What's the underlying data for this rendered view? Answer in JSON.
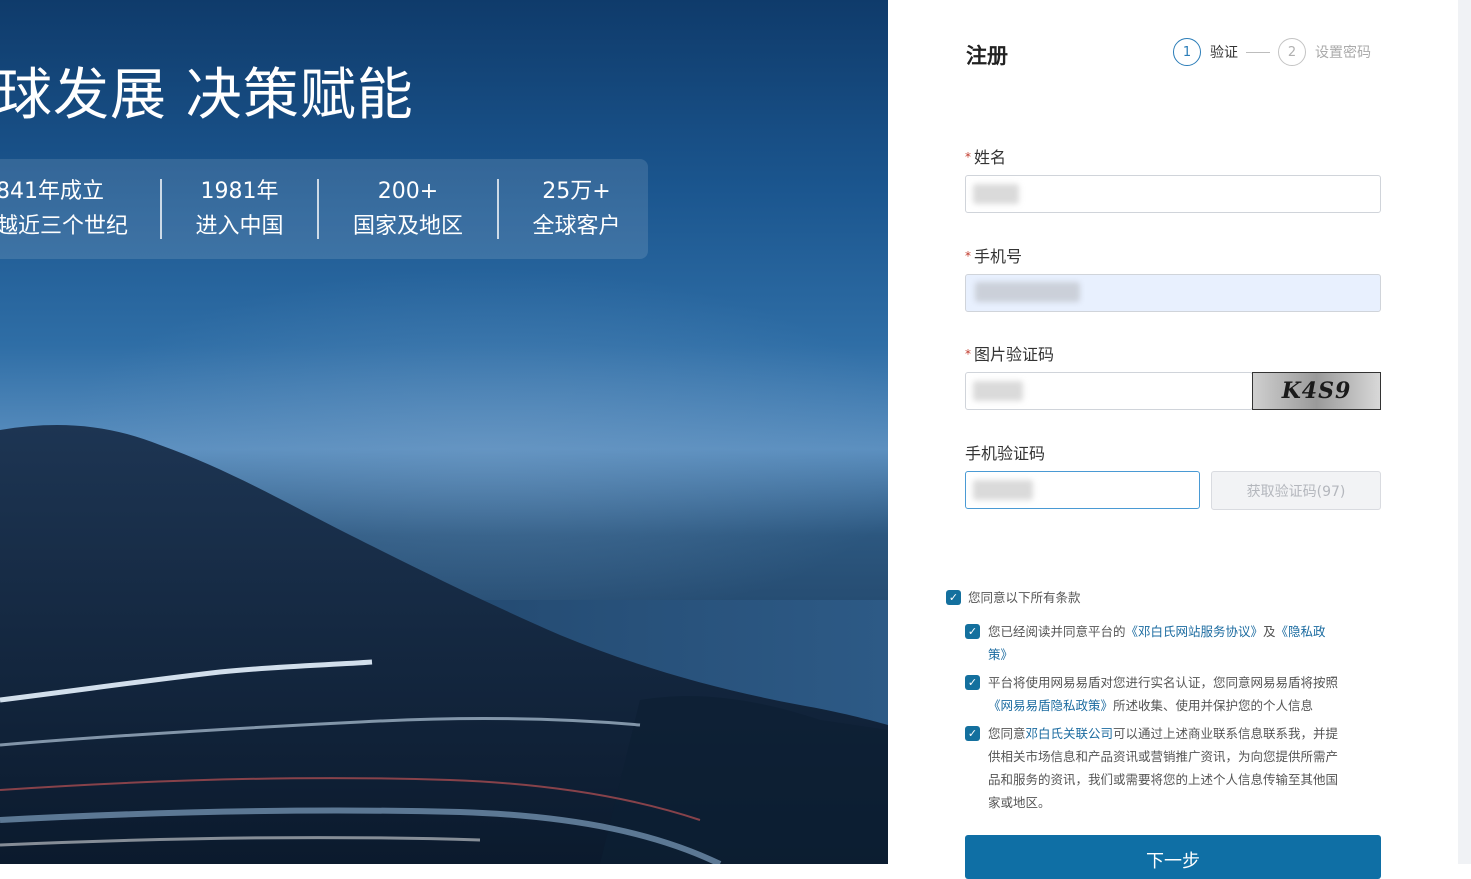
{
  "hero": {
    "title": "球发展 决策赋能",
    "stats": [
      {
        "line1": "841年成立",
        "line2": "越近三个世纪"
      },
      {
        "line1": "1981年",
        "line2": "进入中国"
      },
      {
        "line1": "200+",
        "line2": "国家及地区"
      },
      {
        "line1": "25万+",
        "line2": "全球客户"
      }
    ]
  },
  "form": {
    "title": "注册",
    "steps": [
      {
        "number": "1",
        "label": "验证",
        "active": true
      },
      {
        "number": "2",
        "label": "设置密码",
        "active": false
      }
    ],
    "required_mark": "*",
    "name_label": "姓名",
    "phone_label": "手机号",
    "image_captcha_label": "图片验证码",
    "captcha_text": "K4S9",
    "sms_code_label": "手机验证码",
    "get_code_button": "获取验证码(97)",
    "next_button": "下一步"
  },
  "terms": {
    "agree_all": "您同意以下所有条款",
    "item1": {
      "prefix": "您已经阅读并同意平台的",
      "link1": "《邓白氏网站服务协议》",
      "mid": "及",
      "link2_part1": "《隐私政",
      "link2_part2": "策》"
    },
    "item2": {
      "line1": "平台将使用网易易盾对您进行实名认证，您同意网易易盾将按照",
      "link": "《网易易盾隐私政策》",
      "suffix": "所述收集、使用并保护您的个人信息"
    },
    "item3": {
      "prefix": "您同意",
      "link": "邓白氏关联公司",
      "line1_rest": "可以通过上述商业联系信息联系我，并提",
      "line2": "供相关市场信息和产品资讯或营销推广资讯，为向您提供所需产",
      "line3": "品和服务的资讯，我们或需要将您的上述个人信息传输至其他国",
      "line4": "家或地区。"
    }
  }
}
